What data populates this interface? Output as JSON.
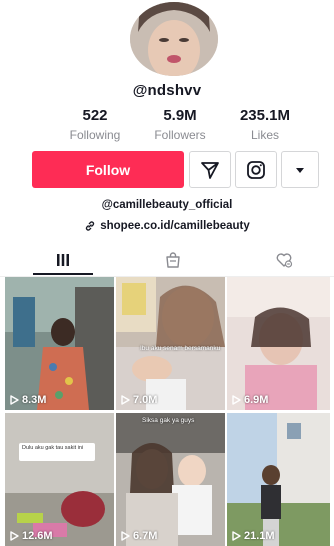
{
  "profile": {
    "handle": "@ndshvv",
    "avatar_icon": "avatar-photo"
  },
  "stats": [
    {
      "value": "522",
      "label": "Following"
    },
    {
      "value": "5.9M",
      "label": "Followers"
    },
    {
      "value": "235.1M",
      "label": "Likes"
    }
  ],
  "actions": {
    "follow_label": "Follow",
    "message_icon": "send-icon",
    "instagram_icon": "instagram-icon",
    "more_icon": "dropdown-arrow-icon"
  },
  "bio": {
    "line1": "@camillebeauty_official",
    "link": "shopee.co.id/camillebeauty",
    "link_icon": "link-icon"
  },
  "tabs": {
    "videos_icon": "grid-icon",
    "shop_icon": "bag-icon",
    "liked_icon": "heart-hidden-icon"
  },
  "videos": [
    {
      "views": "8.3M"
    },
    {
      "views": "7.0M",
      "caption": "Ibu aku senam bersamanku"
    },
    {
      "views": "6.9M"
    },
    {
      "views": "12.6M",
      "caption": "Dulu aku gak tau sakit ini"
    },
    {
      "views": "6.7M",
      "caption": "Siksa gak ya guys"
    },
    {
      "views": "21.1M"
    }
  ],
  "colors": {
    "accent": "#fe2c55",
    "text": "#161823",
    "muted": "#8a8b91"
  }
}
